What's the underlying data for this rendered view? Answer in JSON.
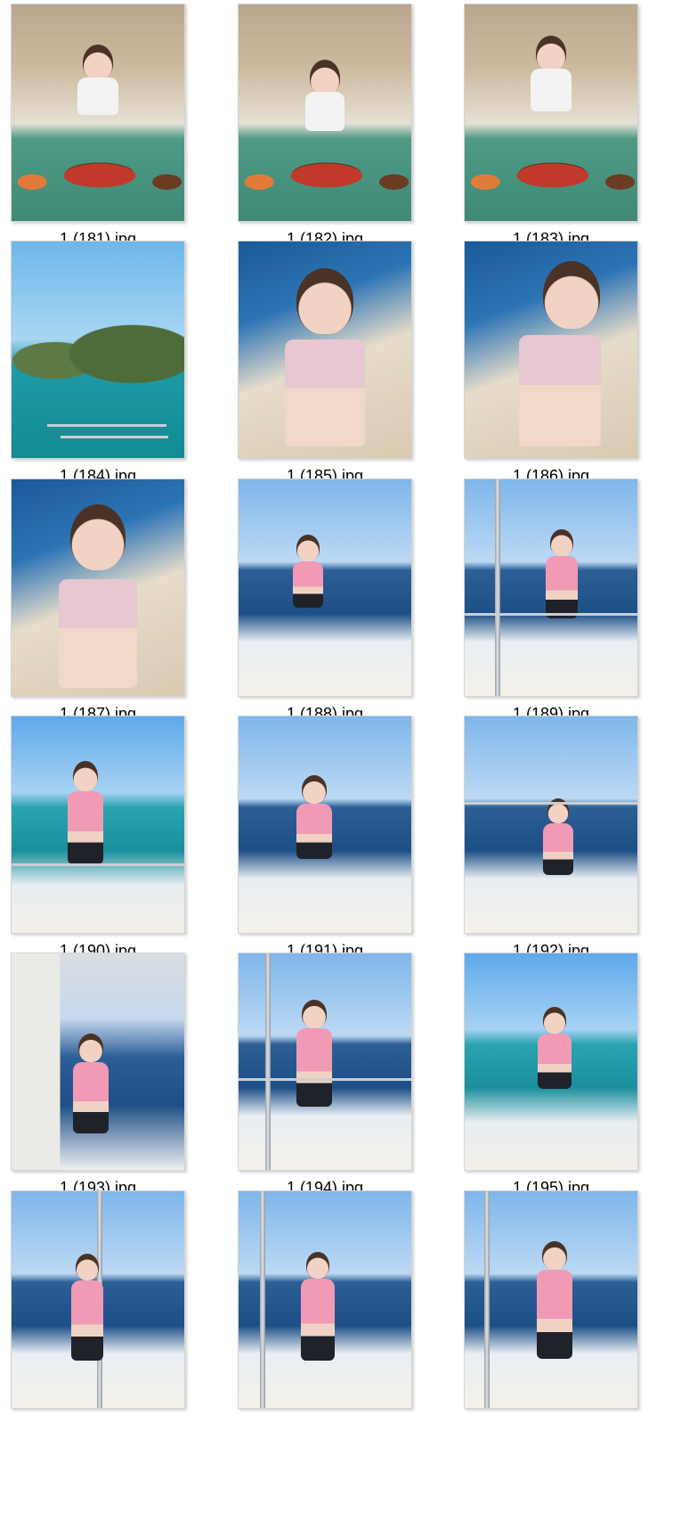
{
  "files": [
    {
      "name": "1 (181).jpg",
      "scene": "restaurant"
    },
    {
      "name": "1 (182).jpg",
      "scene": "restaurant"
    },
    {
      "name": "1 (183).jpg",
      "scene": "restaurant"
    },
    {
      "name": "1 (184).jpg",
      "scene": "island"
    },
    {
      "name": "1 (185).jpg",
      "scene": "selfie"
    },
    {
      "name": "1 (186).jpg",
      "scene": "selfie"
    },
    {
      "name": "1 (187).jpg",
      "scene": "selfie"
    },
    {
      "name": "1 (188).jpg",
      "scene": "boat"
    },
    {
      "name": "1 (189).jpg",
      "scene": "boat"
    },
    {
      "name": "1 (190).jpg",
      "scene": "boat-teal"
    },
    {
      "name": "1 (191).jpg",
      "scene": "boat"
    },
    {
      "name": "1 (192).jpg",
      "scene": "boat"
    },
    {
      "name": "1 (193).jpg",
      "scene": "boat-cabin"
    },
    {
      "name": "1 (194).jpg",
      "scene": "boat"
    },
    {
      "name": "1 (195).jpg",
      "scene": "boat"
    },
    {
      "name": "",
      "scene": "boat"
    },
    {
      "name": "",
      "scene": "boat"
    },
    {
      "name": "",
      "scene": "boat"
    }
  ]
}
